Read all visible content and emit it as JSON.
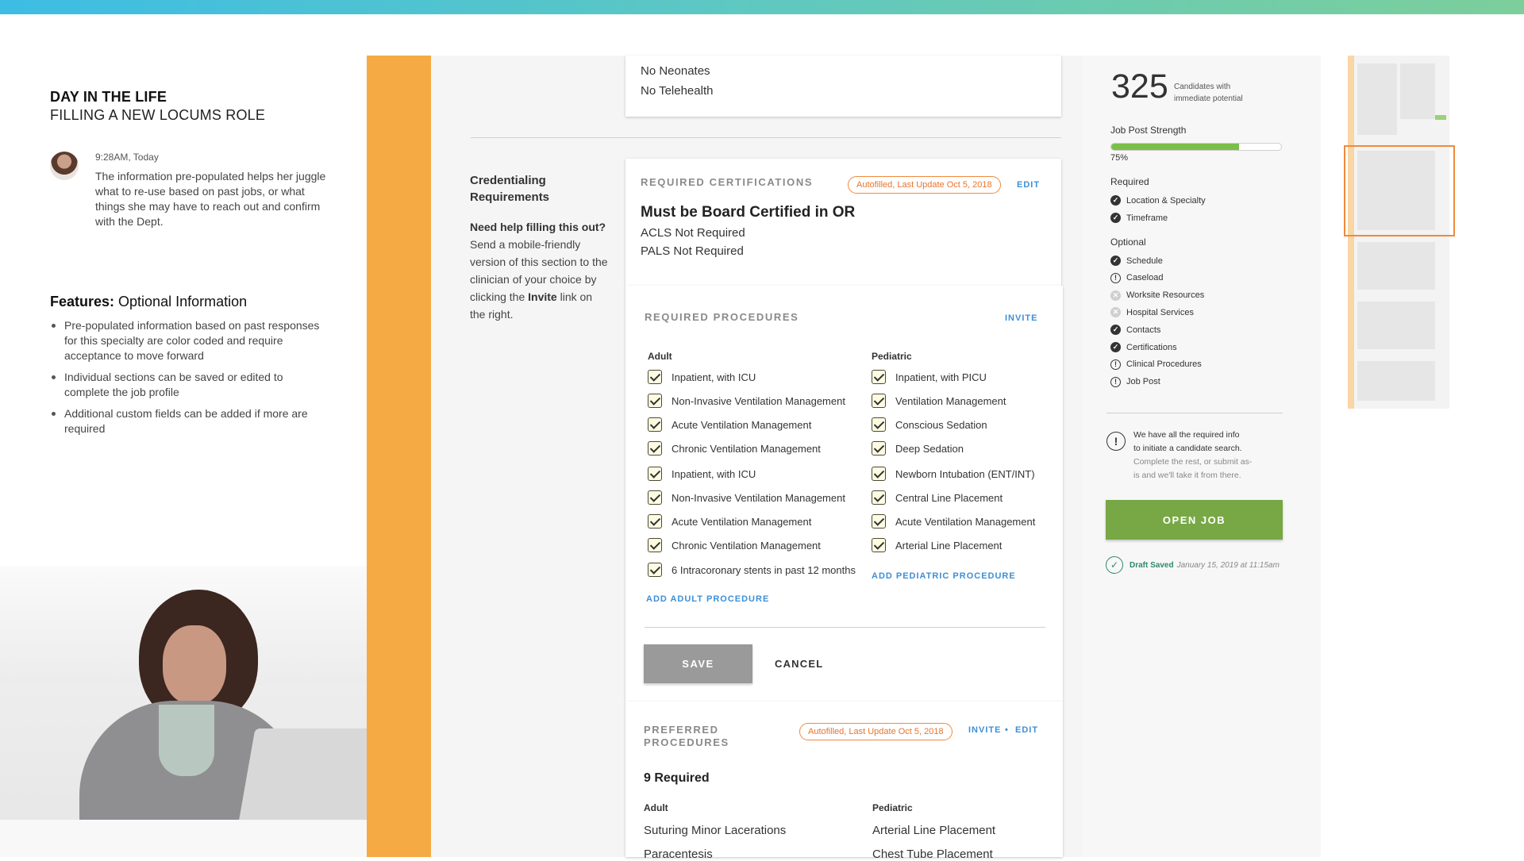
{
  "story": {
    "heading1": "DAY IN THE LIFE",
    "heading2": "FILLING A NEW LOCUMS ROLE",
    "note_time": "9:28AM, Today",
    "note_text": "The information pre-populated helps her juggle what to re-use based on past jobs, or what things she may have to reach out and confirm with the Dept.",
    "features_title_bold": "Features:",
    "features_title_rest": " Optional Information",
    "features": [
      "Pre-populated information based on past responses for this specialty are color coded and require acceptance to move forward",
      "Individual sections can be saved or edited to complete the job profile",
      "Additional custom fields can be added if more are required"
    ]
  },
  "top_card": {
    "lines": [
      "No Neonates",
      "No Telehealth"
    ]
  },
  "credentialing": {
    "title": "Credentialing Requirements",
    "help_bold": "Need help filling this out?",
    "help_text_1": " Send a mobile-friendly version of this section to the clinician of your choice by clicking the ",
    "help_link_word": "Invite",
    "help_text_2": " link on the right."
  },
  "certifications": {
    "title": "REQUIRED CERTIFICATIONS",
    "badge": "Autofilled, Last Update Oct 5, 2018",
    "edit": "EDIT",
    "main": "Must be Board Certified in OR",
    "lines": [
      "ACLS Not Required",
      "PALS Not Required"
    ]
  },
  "procedures": {
    "title": "REQUIRED PROCEDURES",
    "invite": "INVITE",
    "adult_head": "Adult",
    "pediatric_head": "Pediatric",
    "adult": [
      "Inpatient, with ICU",
      "Non-Invasive Ventilation Management",
      "Acute Ventilation Management",
      "Chronic Ventilation Management",
      "Inpatient, with ICU",
      "Non-Invasive Ventilation Management",
      "Acute Ventilation Management",
      "Chronic Ventilation Management",
      "6 Intracoronary stents in past 12 months"
    ],
    "pediatric": [
      "Inpatient, with PICU",
      "Ventilation Management",
      "Conscious Sedation",
      "Deep Sedation",
      "Newborn Intubation (ENT/INT)",
      "Central Line Placement",
      "Acute Ventilation Management",
      "Arterial Line Placement"
    ],
    "add_adult": "ADD ADULT PROCEDURE",
    "add_pediatric": "ADD PEDIATRIC PROCEDURE",
    "save": "SAVE",
    "cancel": "CANCEL"
  },
  "preferred": {
    "title": "PREFERRED PROCEDURES",
    "badge": "Autofilled, Last Update Oct 5, 2018",
    "invite": "INVITE",
    "separator": "•",
    "edit": "EDIT",
    "count": "9 Required",
    "adult_head": "Adult",
    "pediatric_head": "Pediatric",
    "adult": [
      "Suturing Minor Lacerations",
      "Paracentesis"
    ],
    "pediatric": [
      "Arterial Line Placement",
      "Chest Tube Placement"
    ]
  },
  "summary": {
    "count": "325",
    "count_label": "Candidates with immediate potential",
    "strength_label": "Job Post Strength",
    "strength_pct": "75%",
    "strength_value": 0.75,
    "required_label": "Required",
    "required": [
      {
        "label": "Location & Specialty",
        "status": "complete"
      },
      {
        "label": "Timeframe",
        "status": "complete"
      }
    ],
    "optional_label": "Optional",
    "optional": [
      {
        "label": "Schedule",
        "status": "complete"
      },
      {
        "label": "Caseload",
        "status": "warning"
      },
      {
        "label": "Worksite Resources",
        "status": "none"
      },
      {
        "label": "Hospital Services",
        "status": "none"
      },
      {
        "label": "Contacts",
        "status": "complete"
      },
      {
        "label": "Certifications",
        "status": "complete"
      },
      {
        "label": "Clinical Procedures",
        "status": "warning"
      },
      {
        "label": "Job Post",
        "status": "warning"
      }
    ],
    "info_lines": [
      "We have all the required info",
      "to initiate a candidate search."
    ],
    "info_muted": [
      "Complete the rest, or submit as-",
      "is and we'll take it from there."
    ],
    "open_job": "OPEN JOB",
    "draft_saved": "Draft Saved",
    "draft_time": "January 15, 2019 at 11:15am"
  },
  "colors": {
    "accent_orange": "#f6aa43",
    "badge_orange": "#e8742a",
    "link_blue": "#3d8fd6",
    "success_green": "#77a845",
    "draft_green": "#2f8a6a"
  }
}
